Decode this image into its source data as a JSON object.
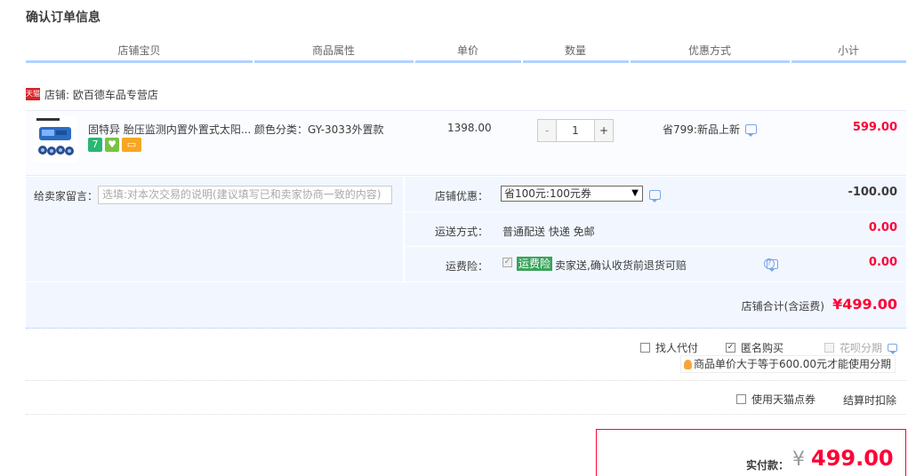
{
  "page_title": "确认订单信息",
  "columns": [
    "店铺宝贝",
    "商品属性",
    "单价",
    "数量",
    "优惠方式",
    "小计"
  ],
  "shop": {
    "badge": "天猫",
    "label": "店铺: 欧百德车品专营店"
  },
  "item": {
    "title": "固特异 胎压监测内置外置式太阳...",
    "attr": "颜色分类：GY-3033外置款",
    "badges": [
      {
        "text": "7",
        "color": "#2bb673"
      },
      {
        "text": "♥",
        "color": "#7ac143"
      },
      {
        "text": "▭",
        "color": "#f6a623"
      }
    ],
    "price": "1398.00",
    "qty_minus": "-",
    "qty_value": "1",
    "qty_plus": "+",
    "promo": "省799:新品上新",
    "subtotal": "599.00"
  },
  "message": {
    "label": "给卖家留言：",
    "placeholder": "选填:对本次交易的说明(建议填写已和卖家协商一致的内容)"
  },
  "shop_discount": {
    "label": "店铺优惠：",
    "selected": "省100元:100元券",
    "amount": "-100.00"
  },
  "shipping": {
    "label": "运送方式：",
    "text": "普通配送 快递 免邮",
    "amount": "0.00"
  },
  "insurance": {
    "label": "运费险：",
    "check": "✓",
    "tag": "运费险",
    "text": "卖家送,确认收货前退货可赔",
    "help": "?",
    "amount": "0.00"
  },
  "shop_total": {
    "label": "店铺合计(含运费)",
    "amount": "¥499.00"
  },
  "options": {
    "find_pay": {
      "label": "找人代付",
      "check": ""
    },
    "anonymous": {
      "label": "匿名购买",
      "check": "✓"
    },
    "huabei": {
      "label": "花呗分期",
      "check": ""
    },
    "tip": "商品单价大于等于600.00元才能使用分期",
    "tmall_points": {
      "label": "使用天猫点券",
      "check": ""
    },
    "deduct_note": "结算时扣除"
  },
  "payment": {
    "label": "实付款：",
    "yen": "¥",
    "amount": "499.00"
  },
  "colors": {
    "accent_red": "#ff0036",
    "header_line": "#b2d1ff",
    "panel_bg": "#f2f7ff"
  }
}
